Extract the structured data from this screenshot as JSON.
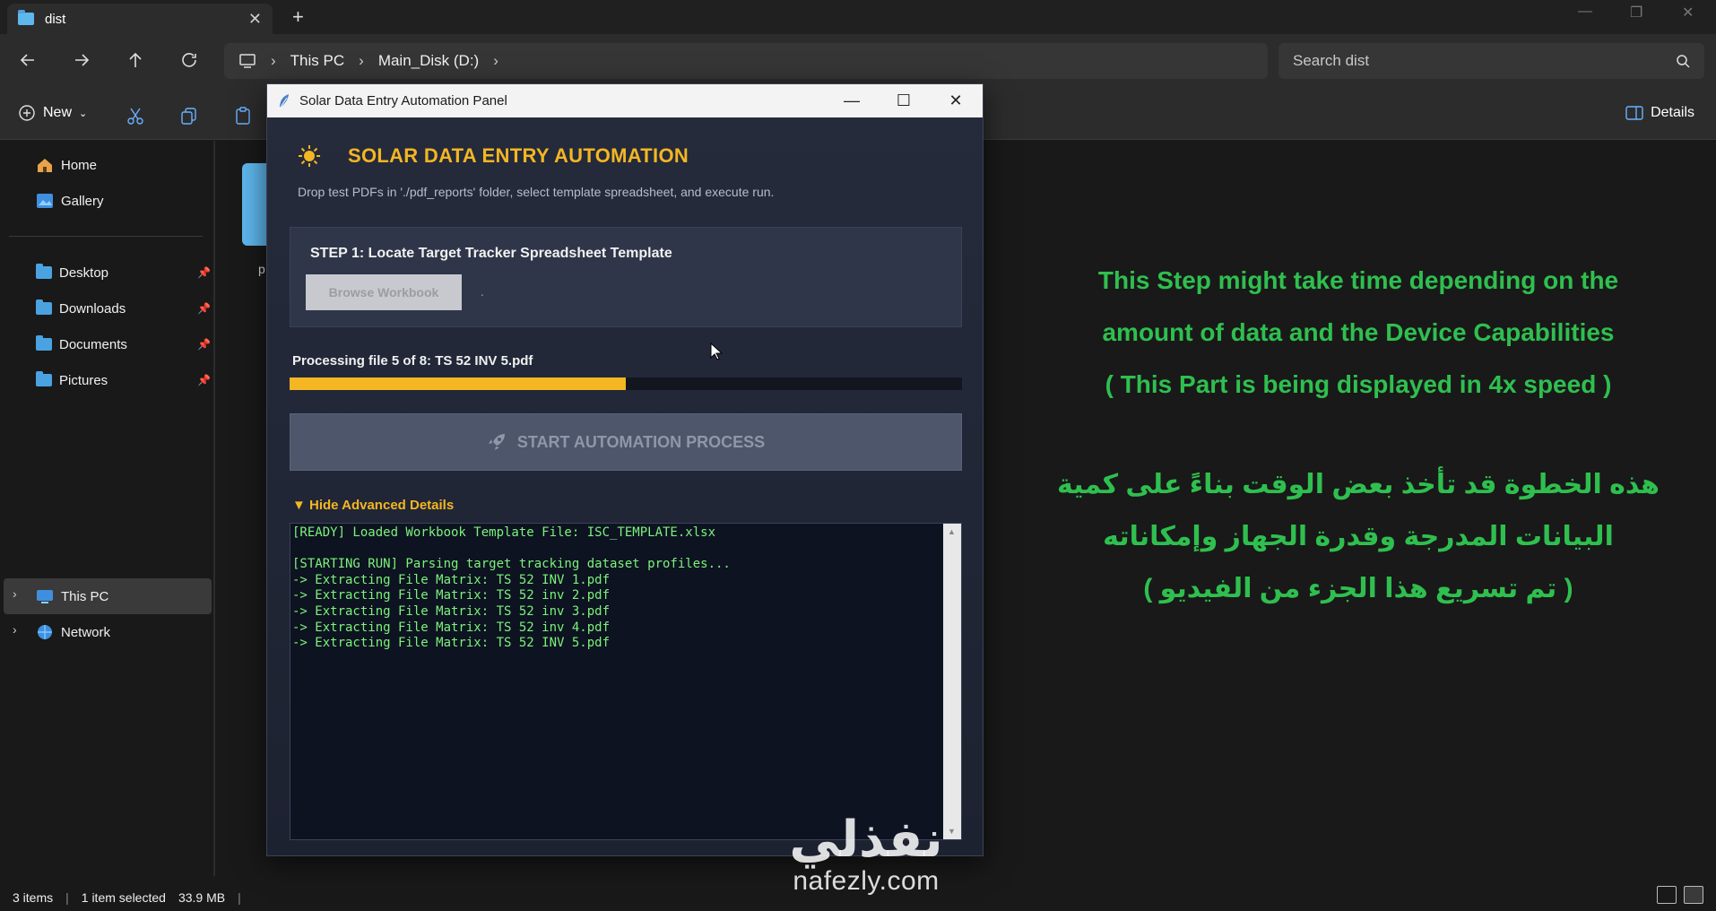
{
  "explorer": {
    "tab_title": "dist",
    "breadcrumb": [
      "This PC",
      "Main_Disk (D:)"
    ],
    "search_placeholder": "Search dist",
    "new_label": "New",
    "details_label": "Details",
    "sidebar": {
      "quick": [
        {
          "label": "Home",
          "icon": "home-icon"
        },
        {
          "label": "Gallery",
          "icon": "gallery-icon"
        }
      ],
      "pinned": [
        {
          "label": "Desktop"
        },
        {
          "label": "Downloads"
        },
        {
          "label": "Documents"
        },
        {
          "label": "Pictures"
        }
      ],
      "tree": [
        {
          "label": "This PC",
          "selected": true
        },
        {
          "label": "Network",
          "selected": false
        }
      ]
    },
    "content_item_label": "p",
    "status": {
      "items": "3 items",
      "selected": "1 item selected",
      "size": "33.9 MB"
    }
  },
  "dialog": {
    "window_title": "Solar Data Entry Automation Panel",
    "heading": "SOLAR DATA ENTRY AUTOMATION",
    "subtitle": "Drop test PDFs in './pdf_reports' folder, select template spreadsheet, and execute run.",
    "step_title": "STEP 1: Locate Target Tracker Spreadsheet Template",
    "browse_label": "Browse Workbook",
    "browse_path": ".",
    "progress_label": "Processing file 5 of 8: TS 52 INV 5.pdf",
    "progress_fraction": 0.5,
    "start_label": "START AUTOMATION PROCESS",
    "advanced_toggle": "▼ Hide Advanced Details",
    "log": [
      "[READY] Loaded Workbook Template File: ISC_TEMPLATE.xlsx",
      "",
      "[STARTING RUN] Parsing target tracking dataset profiles...",
      "-> Extracting File Matrix: TS 52 INV 1.pdf",
      "-> Extracting File Matrix: TS 52 inv 2.pdf",
      "-> Extracting File Matrix: TS 52 inv 3.pdf",
      "-> Extracting File Matrix: TS 52 inv 4.pdf",
      "-> Extracting File Matrix: TS 52 INV 5.pdf"
    ]
  },
  "annotation": {
    "en": [
      "This Step might take time depending on the",
      "amount of data and the Device Capabilities",
      "( This Part is being displayed in 4x speed )"
    ],
    "ar": [
      "هذه الخطوة قد تأخذ بعض الوقت بناءً على كمية",
      "البيانات المدرجة وقدرة الجهاز وإمكاناته",
      "( تم تسريع هذا الجزء من الفيديو )"
    ]
  },
  "watermark": {
    "ar": "نفذلي",
    "en": "nafezly.com"
  },
  "colors": {
    "accent": "#f4b622",
    "log_text": "#7cf27c",
    "annotation": "#2fbf4f",
    "folder": "#4aa3e0"
  }
}
